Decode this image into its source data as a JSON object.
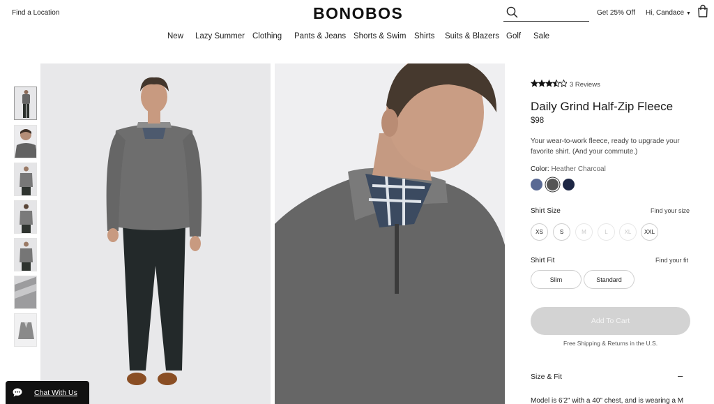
{
  "header": {
    "find_location": "Find a Location",
    "logo": "BONOBOS",
    "search_placeholder": "",
    "promo": "Get 25% Off",
    "greeting": "Hi, Candace"
  },
  "nav": {
    "items": [
      "New",
      "Lazy Summer",
      "Clothing",
      "Pants & Jeans",
      "Shorts & Swim",
      "Shirts",
      "Suits & Blazers",
      "Golf",
      "Sale"
    ]
  },
  "gallery": {
    "thumbnail_count": 7,
    "selected_thumbnail": 1
  },
  "product": {
    "rating": 3.5,
    "rating_max": 5,
    "reviews": "3 Reviews",
    "title": "Daily Grind Half-Zip Fleece",
    "price": "$98",
    "description": "Your wear-to-work fleece, ready to upgrade your favorite shirt. (And your commute.)",
    "color_label": "Color:",
    "color_value": "Heather Charcoal",
    "swatches": [
      {
        "name": "blue",
        "color": "#5a6a94"
      },
      {
        "name": "heather-charcoal",
        "color": "#555555",
        "selected": true
      },
      {
        "name": "navy",
        "color": "#1e2745"
      }
    ],
    "size_label": "Shirt Size",
    "find_size": "Find your size",
    "sizes": [
      {
        "label": "XS",
        "available": true
      },
      {
        "label": "S",
        "available": true
      },
      {
        "label": "M",
        "available": false
      },
      {
        "label": "L",
        "available": false
      },
      {
        "label": "XL",
        "available": false
      },
      {
        "label": "XXL",
        "available": true
      }
    ],
    "fit_label": "Shirt Fit",
    "find_fit": "Find your fit",
    "fits": [
      "Slim",
      "Standard"
    ],
    "add_to_cart": "Add To Cart",
    "shipping": "Free Shipping & Returns in the U.S.",
    "size_fit_heading": "Size & Fit",
    "size_fit_toggle": "–",
    "model_text": "Model is 6'2\" with a 40\" chest, and is wearing a M"
  },
  "chat": {
    "label": "Chat With Us"
  },
  "colors": {
    "brand_text": "#111111",
    "cart_disabled": "#d3d3d3"
  }
}
